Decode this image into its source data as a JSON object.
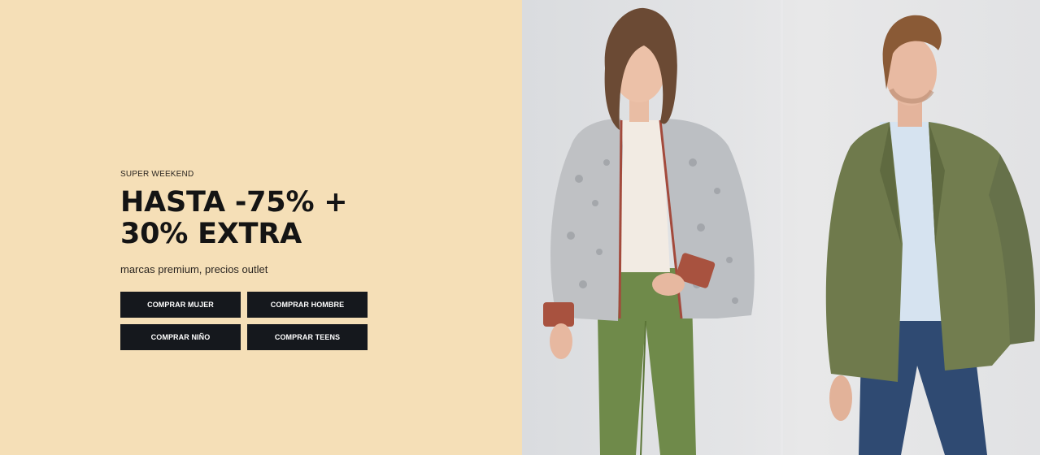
{
  "promo": {
    "eyebrow": "SUPER WEEKEND",
    "headline_line1": "HASTA -75% +",
    "headline_line2": "30% EXTRA",
    "subline": "marcas premium, precios outlet"
  },
  "buttons": [
    {
      "label": "COMPRAR MUJER"
    },
    {
      "label": "COMPRAR HOMBRE"
    },
    {
      "label": "COMPRAR NIÑO"
    },
    {
      "label": "COMPRAR TEENS"
    }
  ],
  "colors": {
    "panel_background": "#f5dfb7",
    "button_background": "#15181d",
    "button_text": "#ffffff",
    "headline_text": "#141414"
  }
}
